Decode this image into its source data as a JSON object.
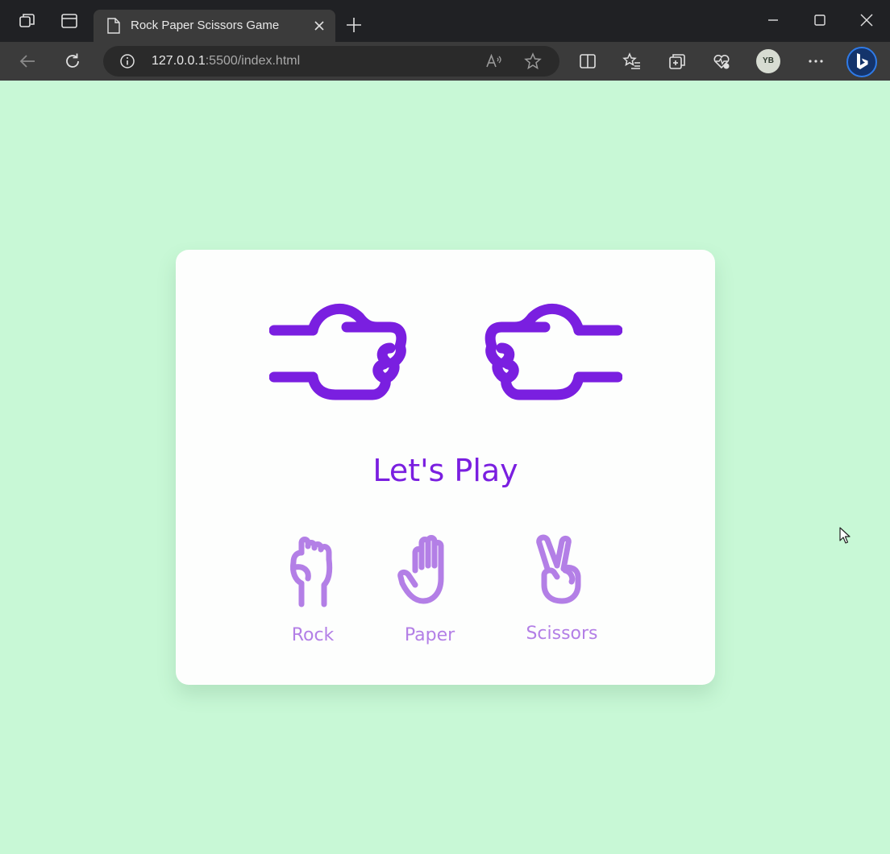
{
  "browser": {
    "tab": {
      "title": "Rock Paper Scissors Game"
    },
    "address": {
      "host": "127.0.0.1",
      "port_path": ":5500/index.html"
    },
    "profile": {
      "initials": "YB"
    }
  },
  "game": {
    "status_text": "Let's Play",
    "options": [
      {
        "label": "Rock"
      },
      {
        "label": "Paper"
      },
      {
        "label": "Scissors"
      }
    ]
  },
  "colors": {
    "page_background": "#c8f8d6",
    "accent": "#7a1fe0",
    "accent_light": "#b37fe6"
  }
}
